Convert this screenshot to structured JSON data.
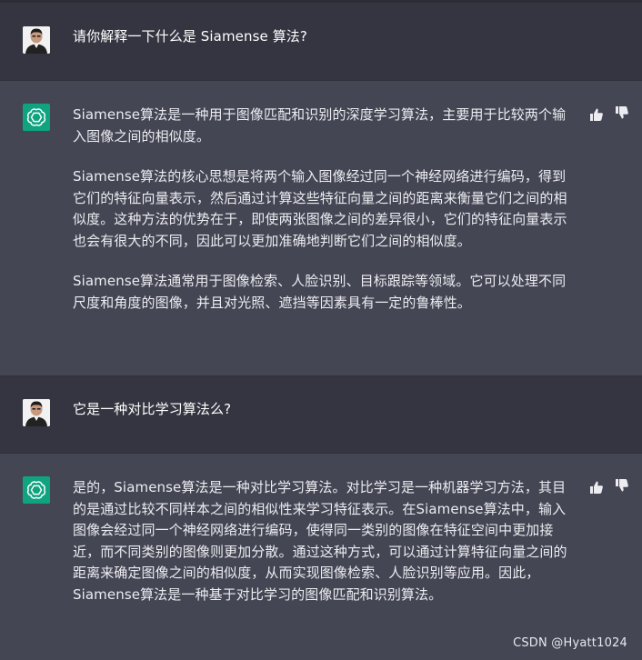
{
  "conversation": {
    "q1": "请你解释一下什么是 Siamense 算法?",
    "a1": [
      "Siamense算法是一种用于图像匹配和识别的深度学习算法，主要用于比较两个输入图像之间的相似度。",
      "Siamense算法的核心思想是将两个输入图像经过同一个神经网络进行编码，得到它们的特征向量表示，然后通过计算这些特征向量之间的距离来衡量它们之间的相似度。这种方法的优势在于，即使两张图像之间的差异很小，它们的特征向量表示也会有很大的不同，因此可以更加准确地判断它们之间的相似度。",
      "Siamense算法通常用于图像检索、人脸识别、目标跟踪等领域。它可以处理不同尺度和角度的图像，并且对光照、遮挡等因素具有一定的鲁棒性。"
    ],
    "q2": "它是一种对比学习算法么?",
    "a2": [
      "是的，Siamense算法是一种对比学习算法。对比学习是一种机器学习方法，其目的是通过比较不同样本之间的相似性来学习特征表示。在Siamense算法中，输入图像会经过同一个神经网络进行编码，使得同一类别的图像在特征空间中更加接近，而不同类别的图像则更加分散。通过这种方式，可以通过计算特征向量之间的距离来确定图像之间的相似度，从而实现图像检索、人脸识别等应用。因此，Siamense算法是一种基于对比学习的图像匹配和识别算法。"
    ]
  },
  "icons": {
    "user_avatar": "user-avatar-photo",
    "assistant_avatar": "openai-logo",
    "upvote": "thumbs-up-icon",
    "downvote": "thumbs-down-icon"
  },
  "watermark": "CSDN @Hyatt1024",
  "colors": {
    "user_bg": "#343541",
    "assistant_bg": "#444654",
    "gpt_green": "#10a37f",
    "text": "#ececf1"
  }
}
